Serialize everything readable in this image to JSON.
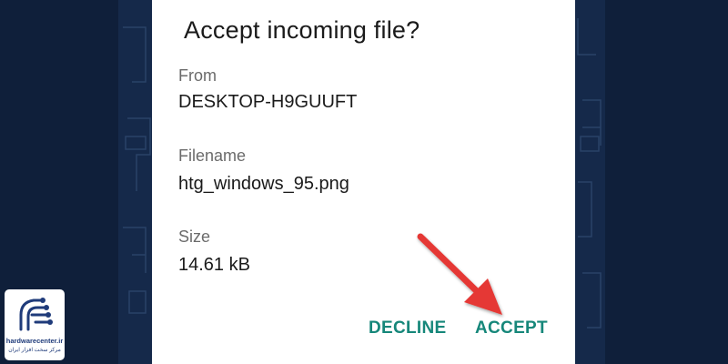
{
  "dialog": {
    "title": "Accept incoming file?",
    "fields": [
      {
        "label": "From",
        "value": "DESKTOP-H9GUUFT"
      },
      {
        "label": "Filename",
        "value": "htg_windows_95.png"
      },
      {
        "label": "Size",
        "value": "14.61 kB"
      }
    ],
    "decline_label": "DECLINE",
    "accept_label": "ACCEPT",
    "button_color": "#16877a"
  },
  "annotation": {
    "arrow_color": "#e53935",
    "points_to": "accept-button"
  },
  "watermark": {
    "brand": "hardwarecenter.ir",
    "subtitle": "مرکز سخت افزار ایران",
    "icon": "circuit-hand-icon"
  },
  "colors": {
    "background": "#0f1f3a",
    "dialog": "#ffffff"
  }
}
